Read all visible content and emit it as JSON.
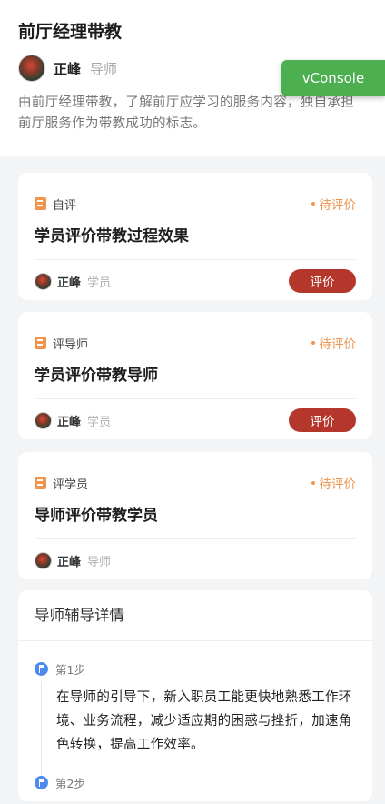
{
  "header": {
    "title": "前厅经理带教",
    "user_name": "正峰",
    "user_role": "导师",
    "description": "由前厅经理带教，了解前厅应学习的服务内容，独自承担前厅服务作为带教成功的标志。"
  },
  "vconsole": {
    "label": "vConsole",
    "color": "#4caf50"
  },
  "tasks": [
    {
      "type": "自评",
      "status": "待评价",
      "title": "学员评价带教过程效果",
      "user_name": "正峰",
      "user_role": "学员",
      "action_label": "评价"
    },
    {
      "type": "评导师",
      "status": "待评价",
      "title": "学员评价带教导师",
      "user_name": "正峰",
      "user_role": "学员",
      "action_label": "评价"
    },
    {
      "type": "评学员",
      "status": "待评价",
      "title": "导师评价带教学员",
      "user_name": "正峰",
      "user_role": "导师"
    }
  ],
  "detail": {
    "title": "导师辅导详情",
    "steps": [
      {
        "label": "第1步",
        "text": "在导师的引导下，新入职员工能更快地熟悉工作环境、业务流程，减少适应期的困惑与挫折，加速角色转换，提高工作效率。"
      },
      {
        "label": "第2步"
      }
    ]
  },
  "colors": {
    "accent_orange": "#f0954f",
    "button_red": "#b5362a",
    "step_blue": "#4c8af0"
  }
}
